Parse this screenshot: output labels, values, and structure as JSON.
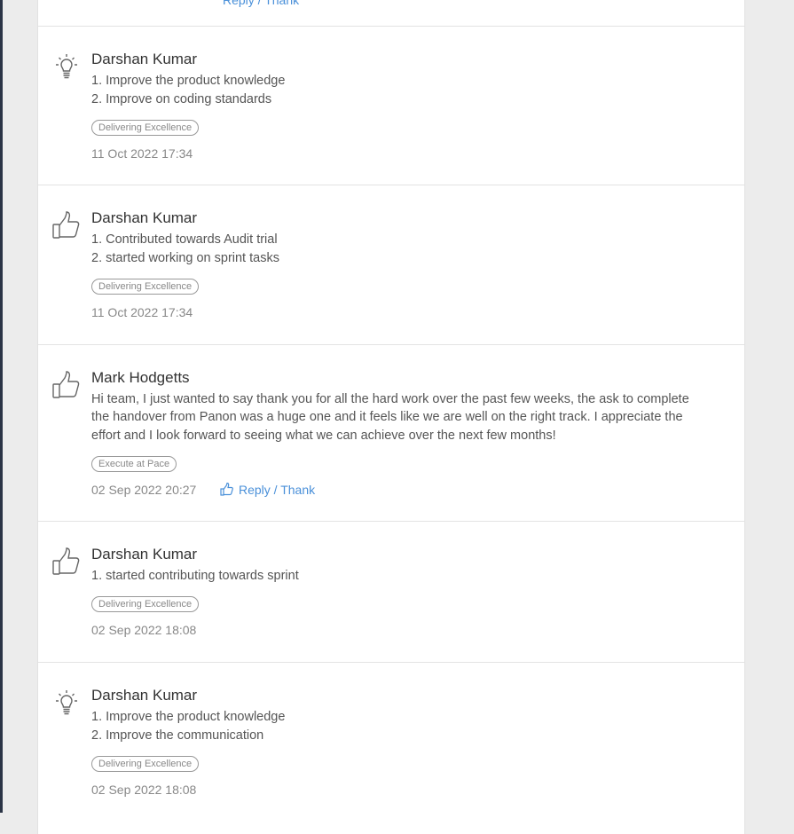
{
  "feed": {
    "partial_reply_label": "Reply / Thank",
    "items": [
      {
        "icon": "lightbulb-icon",
        "author": "Darshan Kumar",
        "lines": [
          "1. Improve the product knowledge",
          "2. Improve on coding standards"
        ],
        "badge": "Delivering Excellence",
        "date": "11 Oct 2022 17:34"
      },
      {
        "icon": "thumbs-up-icon",
        "author": "Darshan Kumar",
        "lines": [
          "1. Contributed towards Audit trial",
          "2. started working on sprint tasks"
        ],
        "badge": "Delivering Excellence",
        "date": "11 Oct 2022 17:34"
      },
      {
        "icon": "thumbs-up-icon",
        "author": "Mark Hodgetts",
        "lines": [
          "Hi team, I just wanted to say thank you for all the hard work over the past few weeks, the ask to complete",
          "the handover from Panon was a huge one and it feels like we are well on the right track. I appreciate the",
          "effort and I look forward to seeing what we can achieve over the next few months!"
        ],
        "badge": "Execute at Pace",
        "date": "02 Sep 2022 20:27",
        "reply_label": "Reply / Thank"
      },
      {
        "icon": "thumbs-up-icon",
        "author": "Darshan Kumar",
        "lines": [
          "1. started contributing towards sprint"
        ],
        "badge": "Delivering Excellence",
        "date": "02 Sep 2022 18:08"
      },
      {
        "icon": "lightbulb-icon",
        "author": "Darshan Kumar",
        "lines": [
          "1. Improve the product knowledge",
          "2. Improve the communication"
        ],
        "badge": "Delivering Excellence",
        "date": "02 Sep 2022 18:08"
      }
    ]
  }
}
